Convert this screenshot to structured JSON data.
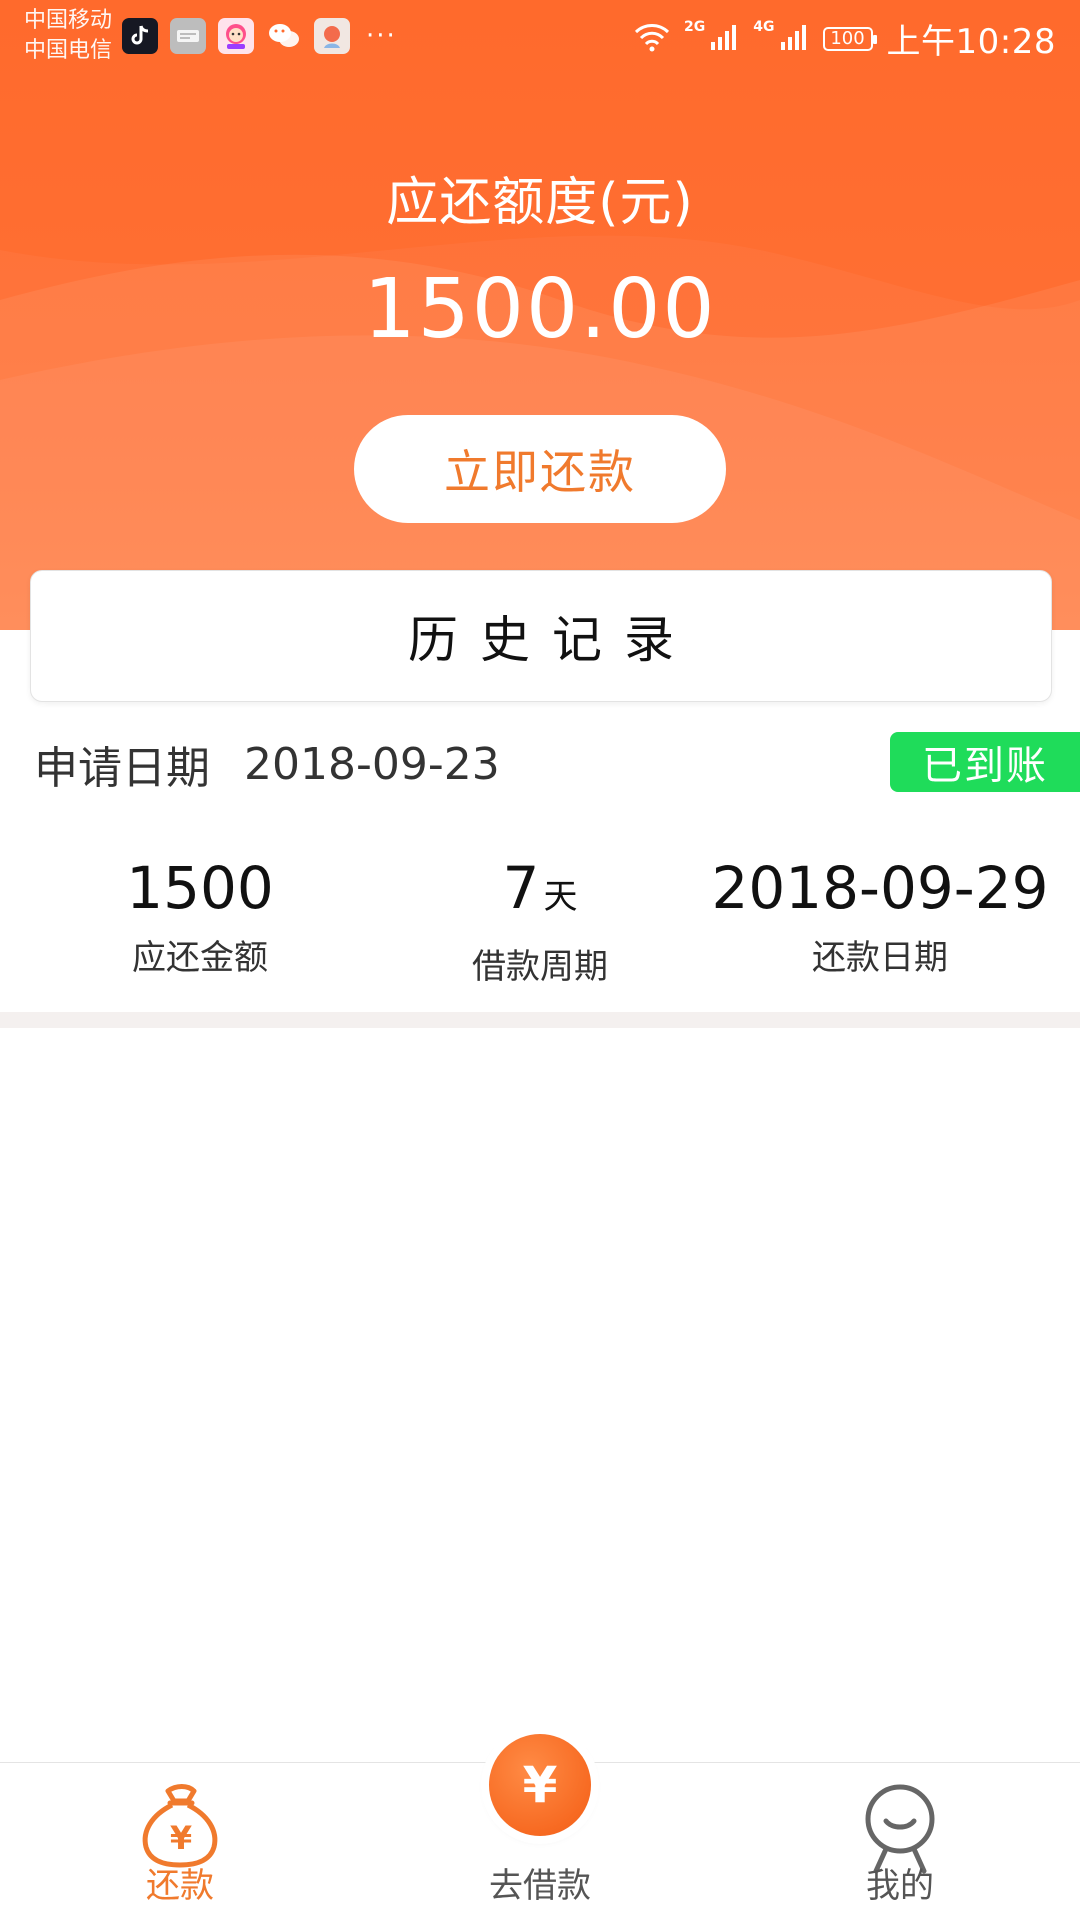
{
  "status_bar": {
    "carrier_1": "中国移动",
    "carrier_2": "中国电信",
    "apps": [
      {
        "icon": "tiktok-icon",
        "color": "#161823"
      },
      {
        "icon": "toutiao-icon",
        "color": "#e6e6e6"
      },
      {
        "icon": "cartoon-app-icon",
        "color": "#ff4f8b"
      },
      {
        "icon": "wechat-icon",
        "color": "#ffffff"
      },
      {
        "icon": "du-app-icon",
        "color": "#ffffff"
      }
    ],
    "more": "···",
    "net_2g": "2G",
    "net_4g": "4G",
    "battery": "100",
    "time": "上午10:28"
  },
  "hero": {
    "title": "应还额度(元)",
    "amount": "1500.00",
    "repay_button": "立即还款",
    "background_color": "#ff6a2c"
  },
  "history": {
    "title": "历史记录"
  },
  "record": {
    "apply_label": "申请日期",
    "apply_date": "2018-09-23",
    "status": "已到账",
    "status_color": "#1fdc5a",
    "stats": [
      {
        "value": "1500",
        "unit": "",
        "caption": "应还金额"
      },
      {
        "value": "7",
        "unit": "天",
        "caption": "借款周期"
      },
      {
        "value": "2018-09-29",
        "unit": "",
        "caption": "还款日期"
      }
    ]
  },
  "tabbar": {
    "accent_color": "#f07a2d",
    "tabs": [
      {
        "label": "还款",
        "icon": "money-bag-icon",
        "active": true
      },
      {
        "label": "去借款",
        "icon": "yuan-icon",
        "active": false
      },
      {
        "label": "我的",
        "icon": "profile-icon",
        "active": false
      }
    ],
    "center_symbol": "¥"
  }
}
